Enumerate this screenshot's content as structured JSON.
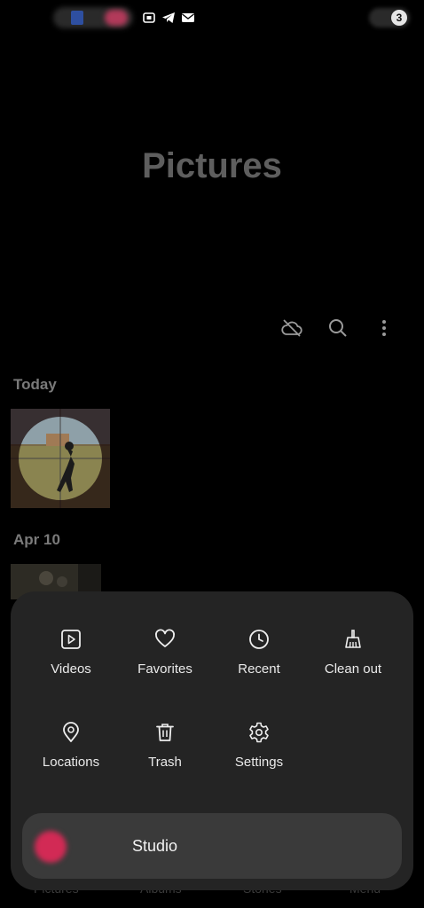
{
  "status_bar": {
    "icons": [
      "screenshot-icon",
      "telegram-icon",
      "mail-icon"
    ],
    "battery_level": "3"
  },
  "page": {
    "title": "Pictures"
  },
  "toolbar": {
    "icons": [
      "cloud-off-icon",
      "search-icon",
      "more-vertical-icon"
    ]
  },
  "sections": [
    {
      "date": "Today"
    },
    {
      "date": "Apr 10"
    }
  ],
  "menu": {
    "items": [
      {
        "label": "Videos",
        "icon": "video-icon"
      },
      {
        "label": "Favorites",
        "icon": "heart-icon"
      },
      {
        "label": "Recent",
        "icon": "clock-icon"
      },
      {
        "label": "Clean out",
        "icon": "broom-icon"
      },
      {
        "label": "Locations",
        "icon": "location-pin-icon"
      },
      {
        "label": "Trash",
        "icon": "trash-icon"
      },
      {
        "label": "Settings",
        "icon": "gear-icon"
      }
    ],
    "studio_label": "Studio"
  },
  "bottom_nav": {
    "tabs": [
      "Pictures",
      "Albums",
      "Stories",
      "Menu"
    ]
  },
  "colors": {
    "background": "#000000",
    "sheet": "#242424",
    "studio_button": "#3a3a3a"
  }
}
